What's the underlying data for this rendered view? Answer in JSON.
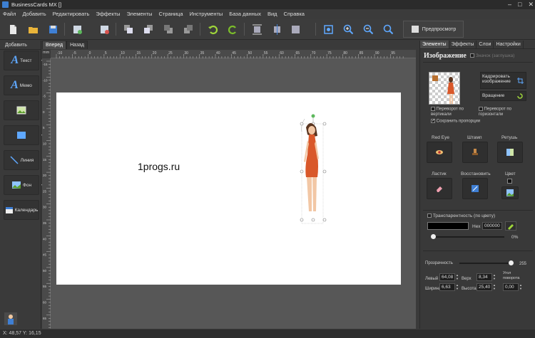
{
  "window": {
    "title": "BusinessCards MX []"
  },
  "menu": [
    "Файл",
    "Добавить",
    "Редактировать",
    "Эффекты",
    "Элементы",
    "Страница",
    "Инструменты",
    "База данных",
    "Вид",
    "Справка"
  ],
  "toolbar": {
    "preview_label": "Предпросмотр"
  },
  "left_panel": {
    "title": "Добавить",
    "buttons": {
      "text": "Текст",
      "memo": "Мемо",
      "line": "Линия",
      "background": "Фон",
      "calendar": "Календарь"
    }
  },
  "doc_tabs": [
    "Вперед",
    "Назад"
  ],
  "ruler_unit": "mm",
  "ruler_h_ticks": [
    "-10",
    "-5",
    "0",
    "5",
    "10",
    "15",
    "20",
    "25",
    "30",
    "35",
    "40",
    "45",
    "50",
    "55",
    "60",
    "65",
    "70",
    "75",
    "80",
    "85",
    "90",
    "95"
  ],
  "ruler_v_ticks": [
    "-15",
    "-10",
    "-5",
    "0",
    "5",
    "10",
    "15",
    "20",
    "25",
    "30",
    "35",
    "40",
    "45",
    "50",
    "55",
    "60",
    "65"
  ],
  "canvas": {
    "text": "1progs.ru"
  },
  "right_panel": {
    "tabs": [
      "Элементы",
      "Эффекты",
      "Слои",
      "Настройки"
    ],
    "section_title": "Изображение",
    "placeholder_chk": "Значок (заглушка)",
    "crop_label": "Кадрировать изображение",
    "rotate_label": "Вращение",
    "flip_v": "Переворот по вертикали",
    "flip_h": "Переворот по горизонтали",
    "keep_ratio": "Сохранить пропорции",
    "fx_labels": {
      "redeye": "Red Eye",
      "stamp": "Штамп",
      "retouch": "Ретушь",
      "eraser": "Ластик",
      "restore": "Восстановить",
      "color": "Цвет"
    },
    "transparency_color": "Транспарентность (по цвету)",
    "hex_label": "Hex",
    "hex_value": "000000",
    "tolerance_value": "0%",
    "opacity_label": "Прозрачность",
    "opacity_value": "255",
    "left_label": "Левый",
    "left_value": "64,08",
    "top_label": "Верх",
    "top_value": "8,34",
    "angle_label": "Угол поворота",
    "angle_value": "0,00",
    "width_label": "Ширина",
    "width_value": "6,63",
    "height_label": "Высота",
    "height_value": "25,40"
  },
  "status": {
    "coords": "X: 48,57 Y: 16,15"
  },
  "colors": {
    "accent_blue": "#2f7fd6",
    "green": "#8fd03a",
    "dress": "#d9582a"
  }
}
